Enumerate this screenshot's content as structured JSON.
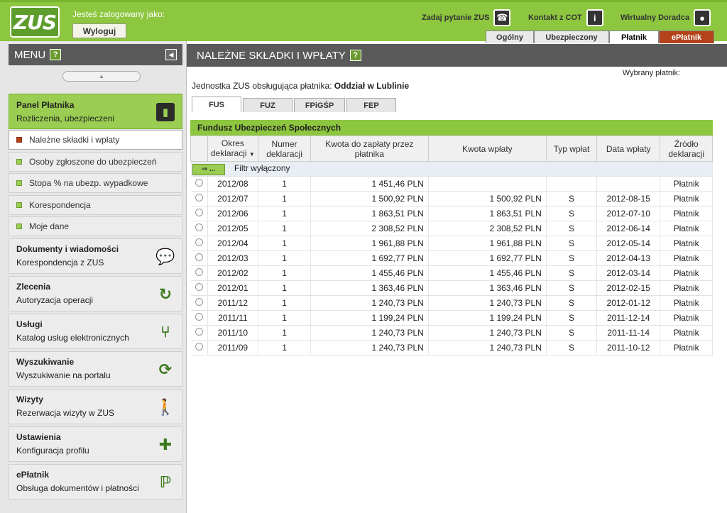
{
  "header": {
    "logo_text": "ZUS",
    "logged_as": "Jesteś zalogowany jako:",
    "logout_label": "Wyloguj",
    "links": [
      {
        "label": "Zadaj pytanie ZUS",
        "icon": "question-icon"
      },
      {
        "label": "Kontakt z COT",
        "icon": "info-icon"
      },
      {
        "label": "Wirtualny Doradca",
        "icon": "person-icon"
      }
    ],
    "tabs": [
      {
        "label": "Ogólny",
        "state": "normal"
      },
      {
        "label": "Ubezpieczony",
        "state": "normal"
      },
      {
        "label": "Płatnik",
        "state": "active"
      },
      {
        "label": "ePłatnik",
        "state": "accent"
      }
    ]
  },
  "menu": {
    "title": "MENU",
    "help": "?",
    "active_panel": {
      "title": "Panel Płatnika",
      "subtitle": "Rozliczenia, ubezpieczeni"
    },
    "subitems": [
      {
        "label": "Należne składki i wpłaty",
        "selected": true
      },
      {
        "label": "Osoby zgłoszone do ubezpieczeń",
        "selected": false
      },
      {
        "label": "Stopa % na ubezp. wypadkowe",
        "selected": false
      },
      {
        "label": "Korespondencja",
        "selected": false
      },
      {
        "label": "Moje dane",
        "selected": false
      }
    ],
    "sections": [
      {
        "title": "Dokumenty i wiadomości",
        "subtitle": "Korespondencja z ZUS",
        "icon": "speech-bubble-icon"
      },
      {
        "title": "Zlecenia",
        "subtitle": "Autoryzacja operacji",
        "icon": "refresh-icon"
      },
      {
        "title": "Usługi",
        "subtitle": "Katalog usług elektronicznych",
        "icon": "network-icon"
      },
      {
        "title": "Wyszukiwanie",
        "subtitle": "Wyszukiwanie na portalu",
        "icon": "sync-icon"
      },
      {
        "title": "Wizyty",
        "subtitle": "Rezerwacja wizyty w ZUS",
        "icon": "walking-person-icon"
      },
      {
        "title": "Ustawienia",
        "subtitle": "Konfiguracja profilu",
        "icon": "puzzle-icon"
      },
      {
        "title": "ePłatnik",
        "subtitle": "Obsługa dokumentów i płatności",
        "icon": "eplatnik-icon"
      }
    ]
  },
  "main": {
    "title": "NALEŻNE SKŁADKI I WPŁATY",
    "help": "?",
    "selected_payer_label": "Wybrany płatnik:",
    "unit_label": "Jednostka ZUS obsługująca płatnika:",
    "unit_value": "Oddział w Lublinie",
    "tabs": [
      "FUS",
      "FUZ",
      "FPiGŚP",
      "FEP"
    ],
    "active_tab": "FUS",
    "fund_title": "Fundusz Ubezpieczeń Społecznych",
    "columns": [
      "Okres deklaracji",
      "Numer deklaracji",
      "Kwota do zapłaty przez płatnika",
      "Kwota wpłaty",
      "Typ wpłat",
      "Data wpłaty",
      "Źródło deklaracji"
    ],
    "filter_button": "...",
    "filter_label": "Filtr wyłączony",
    "rows": [
      {
        "okres": "2012/08",
        "numer": "1",
        "kwota_do_zaplaty": "1 451,46 PLN",
        "kwota_wplaty": "",
        "typ": "",
        "data": "",
        "zrodlo": "Płatnik"
      },
      {
        "okres": "2012/07",
        "numer": "1",
        "kwota_do_zaplaty": "1 500,92 PLN",
        "kwota_wplaty": "1 500,92 PLN",
        "typ": "S",
        "data": "2012-08-15",
        "zrodlo": "Płatnik"
      },
      {
        "okres": "2012/06",
        "numer": "1",
        "kwota_do_zaplaty": "1 863,51 PLN",
        "kwota_wplaty": "1 863,51 PLN",
        "typ": "S",
        "data": "2012-07-10",
        "zrodlo": "Płatnik"
      },
      {
        "okres": "2012/05",
        "numer": "1",
        "kwota_do_zaplaty": "2 308,52 PLN",
        "kwota_wplaty": "2 308,52 PLN",
        "typ": "S",
        "data": "2012-06-14",
        "zrodlo": "Płatnik"
      },
      {
        "okres": "2012/04",
        "numer": "1",
        "kwota_do_zaplaty": "1 961,88 PLN",
        "kwota_wplaty": "1 961,88 PLN",
        "typ": "S",
        "data": "2012-05-14",
        "zrodlo": "Płatnik"
      },
      {
        "okres": "2012/03",
        "numer": "1",
        "kwota_do_zaplaty": "1 692,77 PLN",
        "kwota_wplaty": "1 692,77 PLN",
        "typ": "S",
        "data": "2012-04-13",
        "zrodlo": "Płatnik"
      },
      {
        "okres": "2012/02",
        "numer": "1",
        "kwota_do_zaplaty": "1 455,46 PLN",
        "kwota_wplaty": "1 455,46 PLN",
        "typ": "S",
        "data": "2012-03-14",
        "zrodlo": "Płatnik"
      },
      {
        "okres": "2012/01",
        "numer": "1",
        "kwota_do_zaplaty": "1 363,46 PLN",
        "kwota_wplaty": "1 363,46 PLN",
        "typ": "S",
        "data": "2012-02-15",
        "zrodlo": "Płatnik"
      },
      {
        "okres": "2011/12",
        "numer": "1",
        "kwota_do_zaplaty": "1 240,73 PLN",
        "kwota_wplaty": "1 240,73 PLN",
        "typ": "S",
        "data": "2012-01-12",
        "zrodlo": "Płatnik"
      },
      {
        "okres": "2011/11",
        "numer": "1",
        "kwota_do_zaplaty": "1 199,24 PLN",
        "kwota_wplaty": "1 199,24 PLN",
        "typ": "S",
        "data": "2011-12-14",
        "zrodlo": "Płatnik"
      },
      {
        "okres": "2011/10",
        "numer": "1",
        "kwota_do_zaplaty": "1 240,73 PLN",
        "kwota_wplaty": "1 240,73 PLN",
        "typ": "S",
        "data": "2011-11-14",
        "zrodlo": "Płatnik"
      },
      {
        "okres": "2011/09",
        "numer": "1",
        "kwota_do_zaplaty": "1 240,73 PLN",
        "kwota_wplaty": "1 240,73 PLN",
        "typ": "S",
        "data": "2011-10-12",
        "zrodlo": "Płatnik"
      }
    ]
  },
  "colors": {
    "brand_green": "#8dc63f",
    "dark_header": "#5a5a5a",
    "accent_red": "#b4421b"
  }
}
